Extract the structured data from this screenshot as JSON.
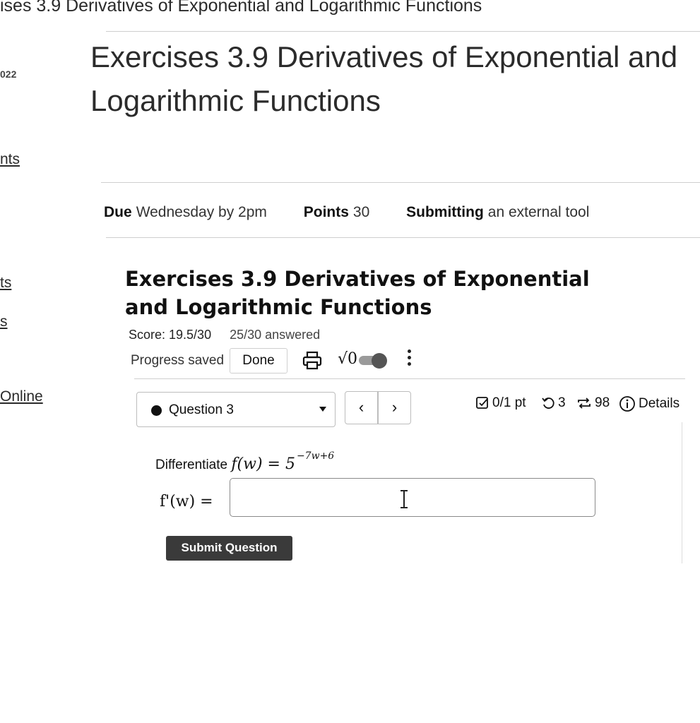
{
  "breadcrumb": "ises 3.9 Derivatives of Exponential and Logarithmic Functions",
  "sidebar": {
    "year_fragment": "022",
    "items": [
      "nts",
      "ts",
      "s",
      "Online"
    ]
  },
  "page_title": "Exercises 3.9 Derivatives of Exponential and Logarithmic Functions",
  "details": {
    "due_label": "Due",
    "due_value": "Wednesday by 2pm",
    "points_label": "Points",
    "points_value": "30",
    "submitting_label": "Submitting",
    "submitting_value": "an external tool"
  },
  "assignment": {
    "title": "Exercises 3.9 Derivatives of Exponential and Logarithmic Functions",
    "score": "Score: 19.5/30",
    "answered": "25/30 answered",
    "progress": "Progress saved",
    "done_label": "Done",
    "sqrt_label": "√0"
  },
  "question": {
    "selector_label": "Question 3",
    "points": "0/1 pt",
    "retries": "3",
    "attempts": "98",
    "details_label": "Details",
    "prompt_text": "Differentiate",
    "function_lhs": "f(w) = 5",
    "function_exp": "−7w+6",
    "answer_label": "f'(w) =",
    "answer_value": "",
    "submit_label": "Submit Question"
  }
}
